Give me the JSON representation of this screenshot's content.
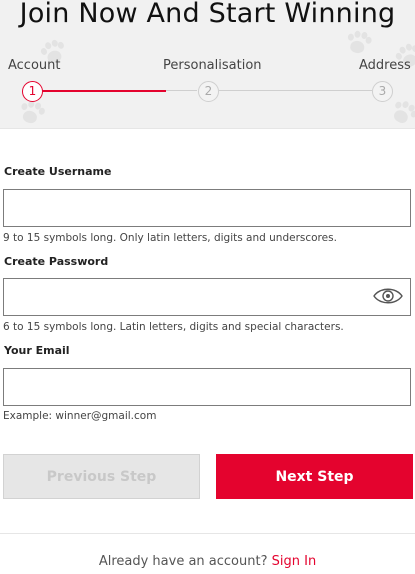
{
  "page": {
    "title": "Join Now And Start Winning"
  },
  "stepper": {
    "steps": [
      {
        "label": "Account",
        "number": "1"
      },
      {
        "label": "Personalisation",
        "number": "2"
      },
      {
        "label": "Address",
        "number": "3"
      }
    ],
    "current_step": 1
  },
  "form": {
    "username": {
      "label": "Create Username",
      "value": "",
      "hint": "9 to 15 symbols long. Only latin letters, digits and underscores."
    },
    "password": {
      "label": "Create Password",
      "value": "",
      "hint": "6 to 15 symbols long. Latin letters, digits and special characters.",
      "toggle_icon": "eye-icon"
    },
    "email": {
      "label": "Your Email",
      "value": "",
      "hint": "Example: winner@gmail.com"
    },
    "previous_label": "Previous Step",
    "next_label": "Next Step"
  },
  "footer": {
    "prompt": "Already have an account?",
    "signin_label": "Sign In"
  },
  "colors": {
    "accent": "#e4032e",
    "disabled_bg": "#e6e6e6",
    "disabled_text": "#c8c8c8"
  }
}
